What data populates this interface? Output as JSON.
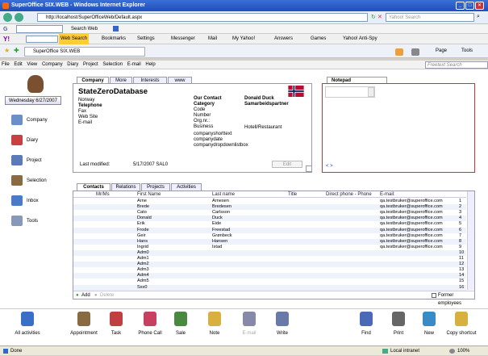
{
  "window": {
    "title": "SuperOffice SIX.WEB - Windows Internet Explorer"
  },
  "address": {
    "url": "http://localhost/SuperOfficeWeb/Default.aspx",
    "search_placeholder": "Yahoo! Search"
  },
  "google": {
    "search_label": "Search Web"
  },
  "yahoo": {
    "items": [
      "Web Search",
      "Bookmarks",
      "Settings",
      "Messenger",
      "Mail",
      "My Yahoo!",
      "Answers",
      "Games",
      "Yahoo! Anti-Spy"
    ]
  },
  "tab": {
    "label": "SuperOffice SIX.WEB"
  },
  "ie_tools": [
    "Page",
    "Tools"
  ],
  "menu": {
    "items": [
      "File",
      "Edit",
      "View",
      "Company",
      "Diary",
      "Project",
      "Selection",
      "E-mail",
      "Help"
    ],
    "search_placeholder": "Freetext Search"
  },
  "nav": {
    "date": "Wednesday 6/27/2007",
    "items": [
      "Company",
      "Diary",
      "Project",
      "Selection",
      "Inbox",
      "Tools"
    ]
  },
  "company": {
    "tabs": [
      "Company",
      "More",
      "Interests",
      "www"
    ],
    "name": "StateZeroDatabase",
    "country": "Norway",
    "fields": [
      "Telephone",
      "Fax",
      "Web Site",
      "E-mail"
    ],
    "our_contact_label": "Our Contact",
    "our_contact": "Donald Duck",
    "category_label": "Category",
    "category": "Samarbeidspartner",
    "misc_fields": [
      "Code",
      "Number",
      "Org.nr.:",
      "Business"
    ],
    "business": "Hotell/Restaurant",
    "extra_fields": [
      "companyshorttext",
      "companydate",
      "companydropdownlistbox"
    ],
    "modified_label": "Last modified:",
    "modified": "5/17/2007 SAL0",
    "edit": "Edit"
  },
  "notepad": {
    "tab": "Notepad",
    "nav": "< >"
  },
  "contacts": {
    "tabs": [
      "Contacts",
      "Relations",
      "Projects",
      "Activities"
    ],
    "headers": [
      "Mr/Ms",
      "First Name",
      "Last name",
      "Title",
      "Direct phone - Phone",
      "E-mail:"
    ],
    "rows": [
      [
        "Arne",
        "Arnesen",
        "qa.testbruker@superoffice.com",
        "1"
      ],
      [
        "Brede",
        "Bredesen",
        "qa.testbruker@superoffice.com",
        "2"
      ],
      [
        "Cato",
        "Carlsson",
        "qa.testbruker@superoffice.com",
        "3"
      ],
      [
        "Donald",
        "Duck",
        "qa.testbruker@superoffice.com",
        "4"
      ],
      [
        "Erik",
        "Eide",
        "qa.testbruker@superoffice.com",
        "5"
      ],
      [
        "Frode",
        "Freestad",
        "qa.testbruker@superoffice.com",
        "6"
      ],
      [
        "Geir",
        "Grønbeck",
        "qa.testbruker@superoffice.com",
        "7"
      ],
      [
        "Hans",
        "Hansen",
        "qa.testbruker@superoffice.com",
        "8"
      ],
      [
        "Ingrid",
        "Istad",
        "qa.testbruker@superoffice.com",
        "9"
      ],
      [
        "Adm0",
        "",
        "",
        "10"
      ],
      [
        "Adm1",
        "",
        "",
        "11"
      ],
      [
        "Adm2",
        "",
        "",
        "12"
      ],
      [
        "Adm3",
        "",
        "",
        "13"
      ],
      [
        "Adm4",
        "",
        "",
        "14"
      ],
      [
        "Adm5",
        "",
        "",
        "15"
      ],
      [
        "Sxx0",
        "",
        "",
        "16"
      ]
    ],
    "add": "Add",
    "delete": "Delete",
    "former": "Former employees"
  },
  "toolbar": {
    "items": [
      "All activities",
      "Appointment",
      "Task",
      "Phone Call",
      "Sale",
      "Note",
      "E-mail",
      "Write",
      "Find",
      "Print",
      "New",
      "Copy shortcut"
    ]
  },
  "status": {
    "left": "Done",
    "zone": "Local intranet",
    "zoom": "100%"
  }
}
